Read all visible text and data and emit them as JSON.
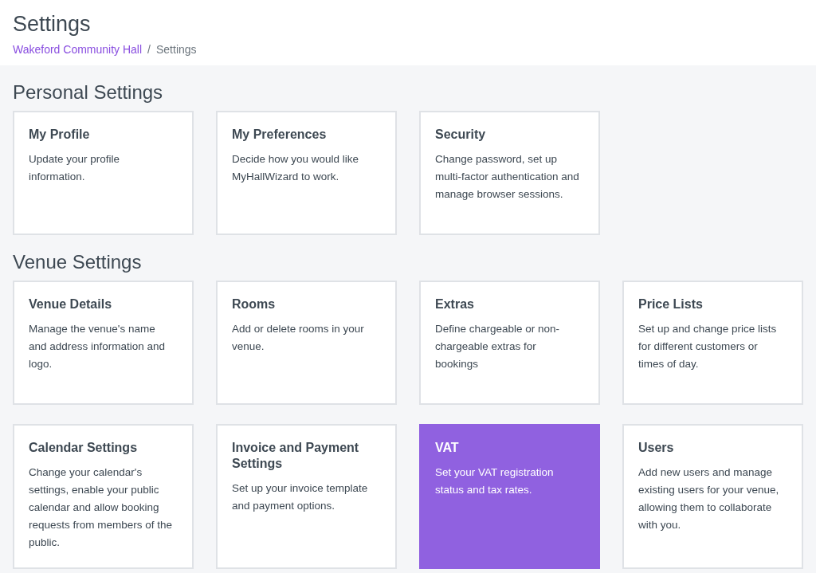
{
  "page": {
    "title": "Settings"
  },
  "breadcrumb_separator": "/",
  "breadcrumb": [
    {
      "label": "Wakeford Community Hall",
      "link": true
    },
    {
      "label": "Settings",
      "link": false
    }
  ],
  "sections": [
    {
      "title": "Personal Settings",
      "cards": [
        {
          "title": "My Profile",
          "description": "Update your profile information.",
          "selected": false
        },
        {
          "title": "My Preferences",
          "description": "Decide how you would like MyHallWizard to work.",
          "selected": false
        },
        {
          "title": "Security",
          "description": "Change password, set up multi-factor authentication and manage browser sessions.",
          "selected": false
        }
      ]
    },
    {
      "title": "Venue Settings",
      "cards": [
        {
          "title": "Venue Details",
          "description": "Manage the venue's name and address information and logo.",
          "selected": false
        },
        {
          "title": "Rooms",
          "description": "Add or delete rooms in your venue.",
          "selected": false
        },
        {
          "title": "Extras",
          "description": "Define chargeable or non-chargeable extras for bookings",
          "selected": false
        },
        {
          "title": "Price Lists",
          "description": "Set up and change price lists for different customers or times of day.",
          "selected": false
        },
        {
          "title": "Calendar Settings",
          "description": "Change your calendar's settings, enable your public calendar and allow booking requests from members of the public.",
          "selected": false
        },
        {
          "title": "Invoice and Payment Settings",
          "description": "Set up your invoice template and payment options.",
          "selected": false
        },
        {
          "title": "VAT",
          "description": "Set your VAT registration status and tax rates.",
          "selected": true
        },
        {
          "title": "Users",
          "description": "Add new users and manage existing users for your venue, allowing them to collaborate with you.",
          "selected": false
        }
      ]
    }
  ]
}
